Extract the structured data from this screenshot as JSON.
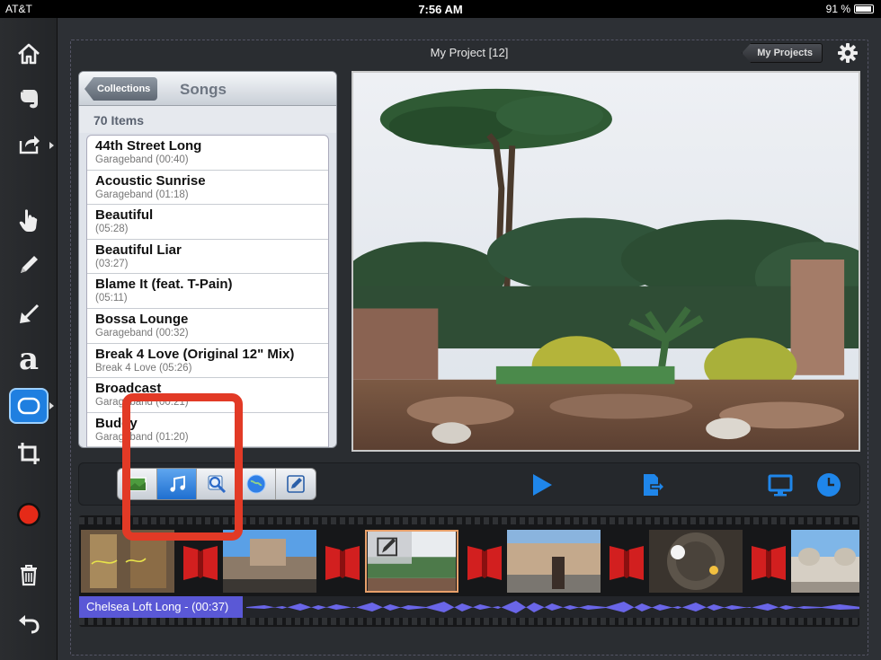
{
  "status_bar": {
    "carrier": "AT&T",
    "time": "7:56 AM",
    "battery": "91 %"
  },
  "toolbar": {
    "tools": [
      "home-icon",
      "evernote-icon",
      "share-icon",
      "hand-pointer-icon",
      "pencil-icon",
      "arrow-icon",
      "text-tool-icon",
      "shape-tool-icon",
      "crop-icon",
      "record-icon",
      "trash-icon",
      "undo-icon"
    ],
    "text_tool_glyph": "a"
  },
  "header": {
    "title": "My Project  [12]",
    "my_projects_label": "My Projects"
  },
  "songs_panel": {
    "back_label": "Collections",
    "title": "Songs",
    "count": "70 Items",
    "items": [
      {
        "name": "44th Street Long",
        "sub": "Garageband (00:40)"
      },
      {
        "name": "Acoustic Sunrise",
        "sub": "Garageband (01:18)"
      },
      {
        "name": "Beautiful",
        "sub": " (05:28)"
      },
      {
        "name": "Beautiful Liar",
        "sub": " (03:27)"
      },
      {
        "name": "Blame It (feat. T-Pain)",
        "sub": " (05:11)"
      },
      {
        "name": "Bossa Lounge",
        "sub": "Garageband (00:32)"
      },
      {
        "name": "Break 4 Love (Original 12\" Mix)",
        "sub": "Break 4 Love (05:26)"
      },
      {
        "name": "Broadcast",
        "sub": "Garageband (00:21)"
      },
      {
        "name": "Buddy",
        "sub": "Garageband (01:20)"
      }
    ]
  },
  "media_tabs": [
    "photos-icon",
    "music-icon",
    "search-icon",
    "globe-icon",
    "edit-icon"
  ],
  "media_tab_selected": "music-icon",
  "controls": {
    "play": "play-icon",
    "export": "export-icon",
    "display": "monitor-icon",
    "timer": "clock-icon"
  },
  "timeline": {
    "audio_label": "Chelsea Loft Long - (00:37)",
    "clip_count": 6
  },
  "colors": {
    "accent": "#1f7fe0",
    "highlight": "#e23a26",
    "audio": "#5a58d6"
  }
}
